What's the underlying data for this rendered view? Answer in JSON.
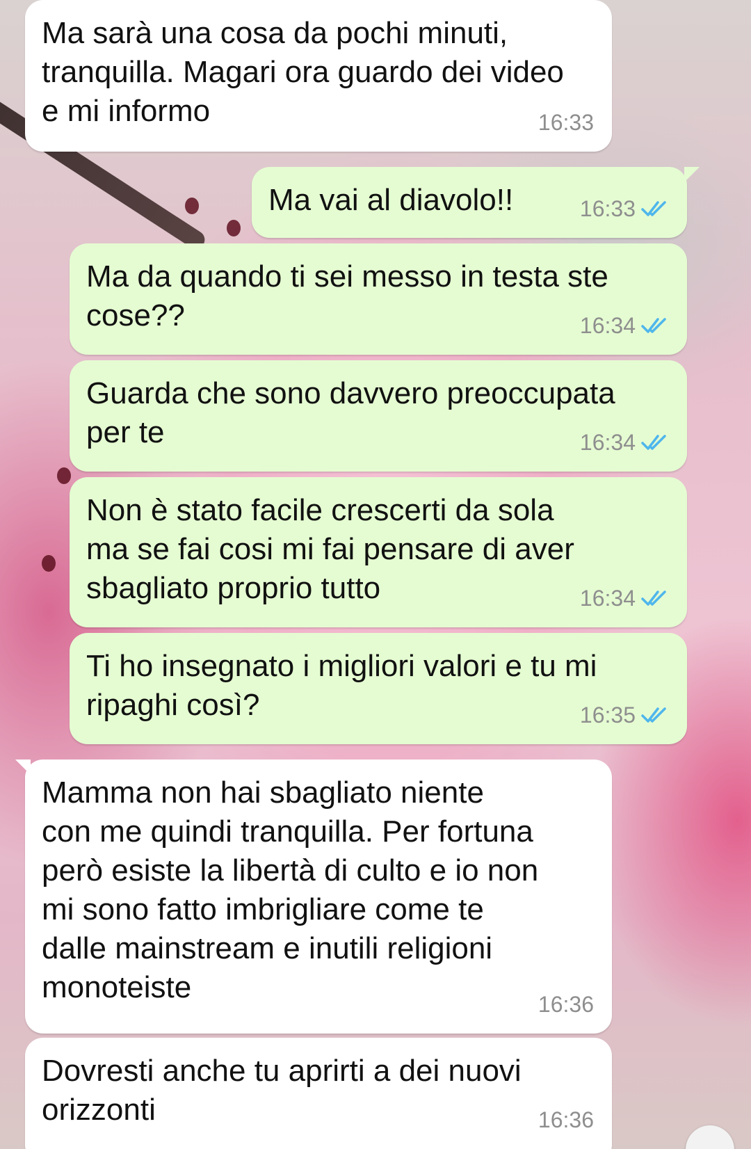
{
  "chat": {
    "messages": [
      {
        "direction": "incoming",
        "text": "Ma sarà una cosa da pochi minuti,\ntranquilla. Magari ora guardo dei video\ne mi informo",
        "time": "16:33"
      },
      {
        "direction": "outgoing",
        "text": "Ma vai al diavolo!!",
        "time": "16:33",
        "status_icon": "double-check-read-icon"
      },
      {
        "direction": "outgoing",
        "text": "Ma da quando ti sei messo in testa ste\ncose??",
        "time": "16:34",
        "status_icon": "double-check-read-icon"
      },
      {
        "direction": "outgoing",
        "text": "Guarda che sono davvero preoccupata\nper te",
        "time": "16:34",
        "status_icon": "double-check-read-icon"
      },
      {
        "direction": "outgoing",
        "text": "Non è stato facile crescerti da sola\nma se fai cosi mi fai pensare di aver\nsbagliato proprio tutto",
        "time": "16:34",
        "status_icon": "double-check-read-icon"
      },
      {
        "direction": "outgoing",
        "text": "Ti ho insegnato i migliori valori e tu mi\nripaghi così?",
        "time": "16:35",
        "status_icon": "double-check-read-icon"
      },
      {
        "direction": "incoming",
        "text": "Mamma non hai sbagliato niente\ncon me quindi tranquilla. Per fortuna\nperò esiste la libertà di culto e io non\nmi sono fatto imbrigliare come te\ndalle mainstream e inutili religioni\nmonoteiste",
        "time": "16:36"
      },
      {
        "direction": "incoming",
        "text": "Dovresti anche tu aprirti a dei nuovi\norizzonti",
        "time": "16:36"
      }
    ]
  },
  "colors": {
    "incoming_bubble": "#ffffff",
    "outgoing_bubble": "#e5fcd2",
    "read_tick": "#4fb6ec",
    "timestamp": "#8e8e8e"
  }
}
